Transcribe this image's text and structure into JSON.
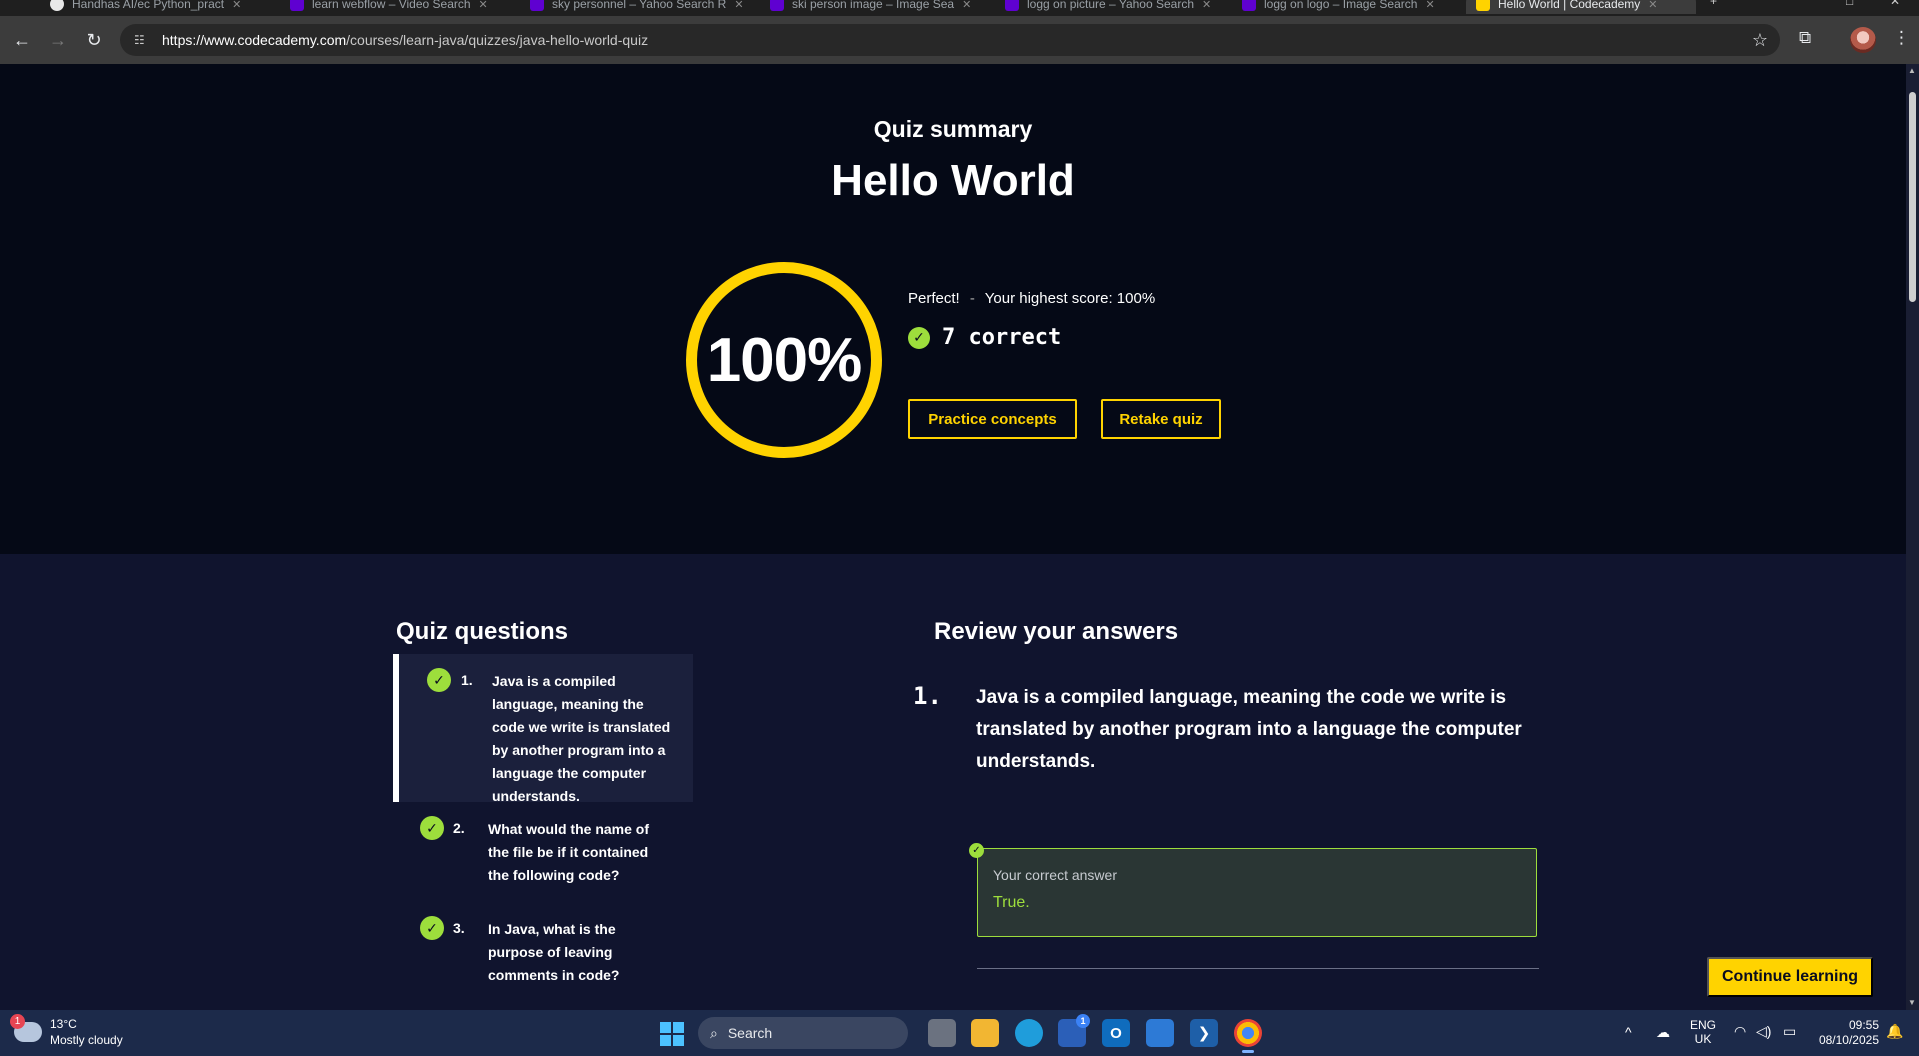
{
  "browser": {
    "tabs": [
      {
        "title": "Handhas AI/ec Python_pract"
      },
      {
        "title": "learn webflow – Video Search"
      },
      {
        "title": "sky personnel – Yahoo Search R"
      },
      {
        "title": "ski person image – Image Sea"
      },
      {
        "title": "logg on picture – Yahoo Search"
      },
      {
        "title": "logg on logo – Image Search"
      },
      {
        "title": "Hello World | Codecademy"
      }
    ],
    "url_host": "https://www.codecademy.com",
    "url_path": "/courses/learn-java/quizzes/java-hello-world-quiz"
  },
  "summary": {
    "eyebrow": "Quiz summary",
    "title": "Hello World",
    "score_display": "100%",
    "score_value": 100,
    "status": "Perfect!",
    "separator": "-",
    "highest": "Your highest score: 100%",
    "correct_text": "7 correct",
    "practice_label": "Practice concepts",
    "retake_label": "Retake quiz"
  },
  "questions_panel": {
    "heading": "Quiz questions",
    "items": [
      {
        "num": "1.",
        "text": "Java is a compiled language, meaning the code we write is translated by another program into a language the computer understands."
      },
      {
        "num": "2.",
        "text": "What would the name of the file be if it contained the following code?"
      },
      {
        "num": "3.",
        "text": "In Java, what is the purpose of leaving comments in code?"
      }
    ]
  },
  "review": {
    "heading": "Review your answers",
    "num": "1.",
    "question": "Java is a compiled language, meaning the code we write is translated by another program into a language the computer understands.",
    "answer_label": "Your correct answer",
    "answer_value": "True."
  },
  "continue_label": "Continue learning",
  "taskbar": {
    "temp": "13°C",
    "weather": "Mostly cloudy",
    "weather_badge": "1",
    "search_label": "Search",
    "store_badge": "1",
    "lang_1": "ENG",
    "lang_2": "UK",
    "time": "09:55",
    "date": "08/10/2025"
  },
  "colors": {
    "accent": "#ffd300",
    "success": "#9dde3c",
    "hero_bg": "#050916",
    "lower_bg": "#10142e"
  }
}
